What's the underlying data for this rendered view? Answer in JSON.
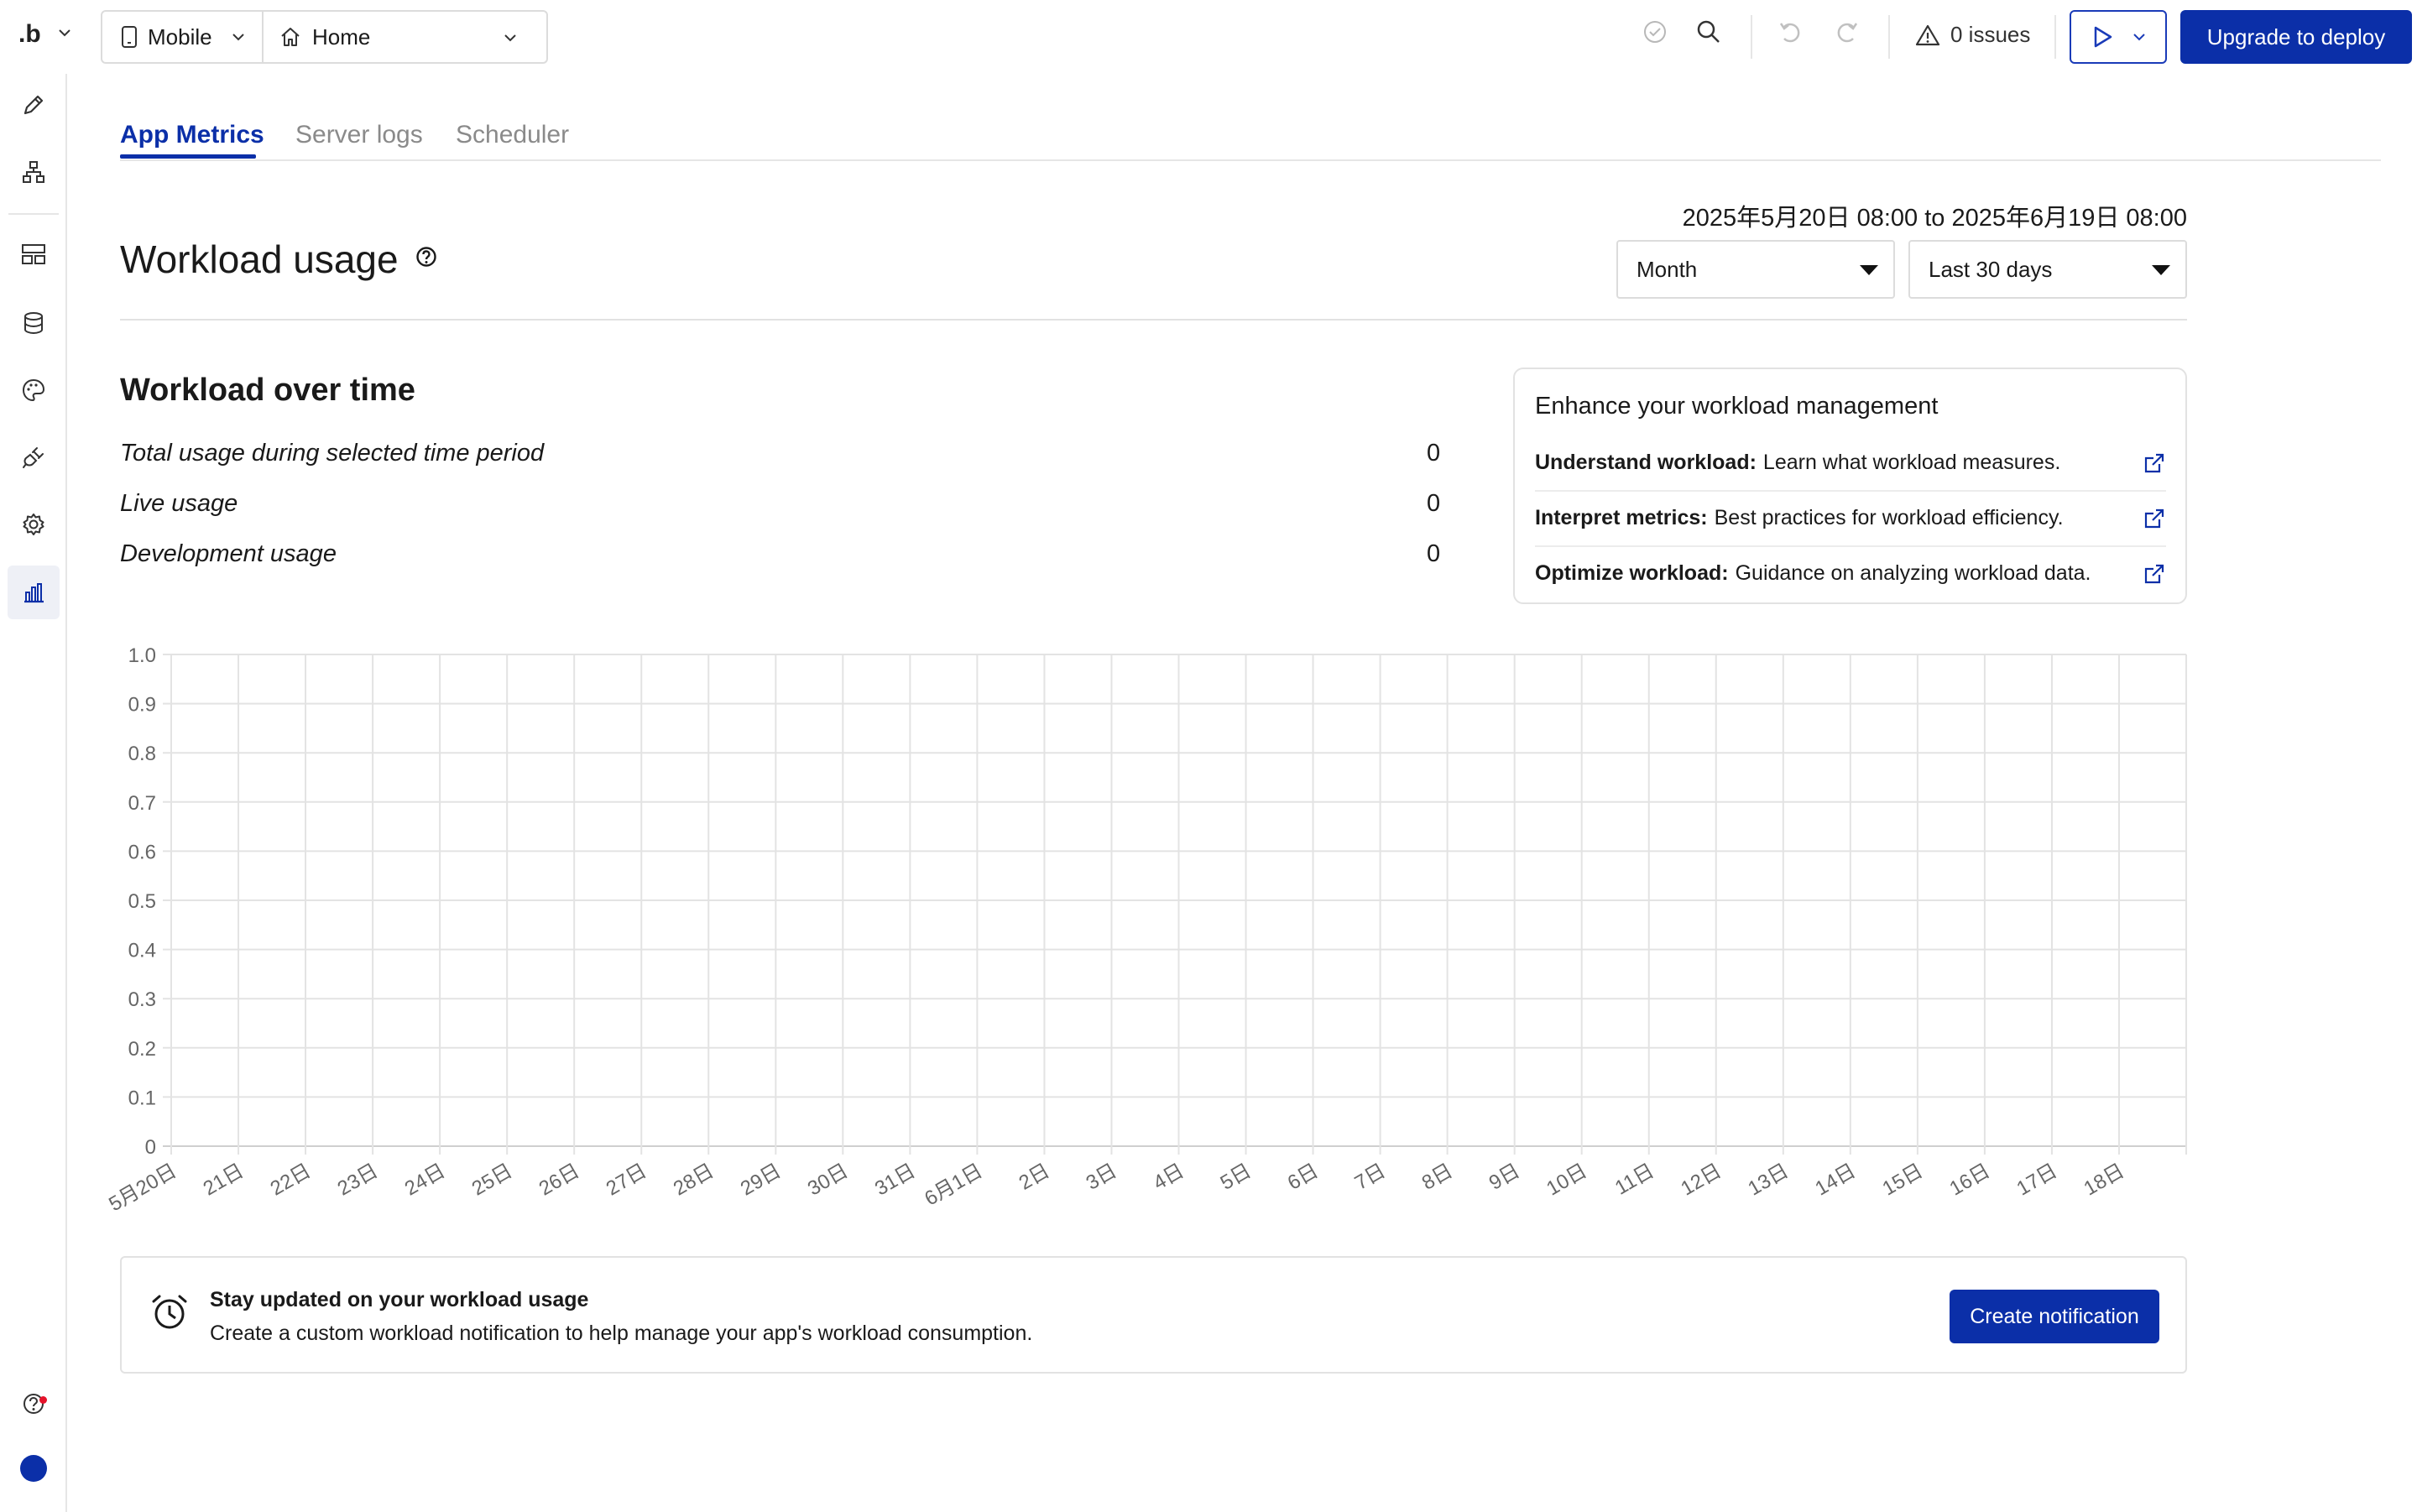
{
  "topbar": {
    "logo": ".b",
    "device": "Mobile",
    "page": "Home",
    "issues": "0 issues",
    "deploy_label": "Upgrade to deploy"
  },
  "tabs": [
    {
      "label": "App Metrics",
      "active": true
    },
    {
      "label": "Server logs",
      "active": false
    },
    {
      "label": "Scheduler",
      "active": false
    }
  ],
  "header": {
    "title": "Workload usage",
    "date_range": "2025年5月20日 08:00 to 2025年6月19日 08:00",
    "granularity": "Month",
    "period": "Last 30 days"
  },
  "workload": {
    "section_title": "Workload over time",
    "stats": [
      {
        "label": "Total usage during selected time period",
        "value": "0"
      },
      {
        "label": "Live usage",
        "value": "0"
      },
      {
        "label": "Development usage",
        "value": "0"
      }
    ]
  },
  "resources": {
    "title": "Enhance your workload management",
    "links": [
      {
        "bold": "Understand workload:",
        "text": "Learn what workload measures."
      },
      {
        "bold": "Interpret metrics:",
        "text": "Best practices for workload efficiency."
      },
      {
        "bold": "Optimize workload:",
        "text": "Guidance on analyzing workload data."
      }
    ]
  },
  "chart_data": {
    "type": "line",
    "title": "",
    "xlabel": "",
    "ylabel": "",
    "ylim": [
      0,
      1
    ],
    "yticks": [
      "0",
      "0.1",
      "0.2",
      "0.3",
      "0.4",
      "0.5",
      "0.6",
      "0.7",
      "0.8",
      "0.9",
      "1.0"
    ],
    "categories": [
      "5月20日",
      "21日",
      "22日",
      "23日",
      "24日",
      "25日",
      "26日",
      "27日",
      "28日",
      "29日",
      "30日",
      "31日",
      "6月1日",
      "2日",
      "3日",
      "4日",
      "5日",
      "6日",
      "7日",
      "8日",
      "9日",
      "10日",
      "11日",
      "12日",
      "13日",
      "14日",
      "15日",
      "16日",
      "17日",
      "18日"
    ],
    "series": [],
    "grid": true
  },
  "banner": {
    "title": "Stay updated on your workload usage",
    "text": "Create a custom workload notification to help manage your app's workload consumption.",
    "button": "Create notification"
  },
  "colors": {
    "accent": "#0b2fa8",
    "grid": "#e3e3e3",
    "alert_dot": "#e5132b"
  },
  "icons": {
    "sidebar": [
      "pencil-icon",
      "sitemap-icon",
      "layout-icon",
      "database-icon",
      "palette-icon",
      "plugin-icon",
      "gear-icon",
      "bar-chart-icon",
      "help-circle-icon"
    ],
    "toolbar": [
      "check-circle-icon",
      "search-icon",
      "undo-icon",
      "redo-icon",
      "warning-icon",
      "play-icon"
    ]
  }
}
